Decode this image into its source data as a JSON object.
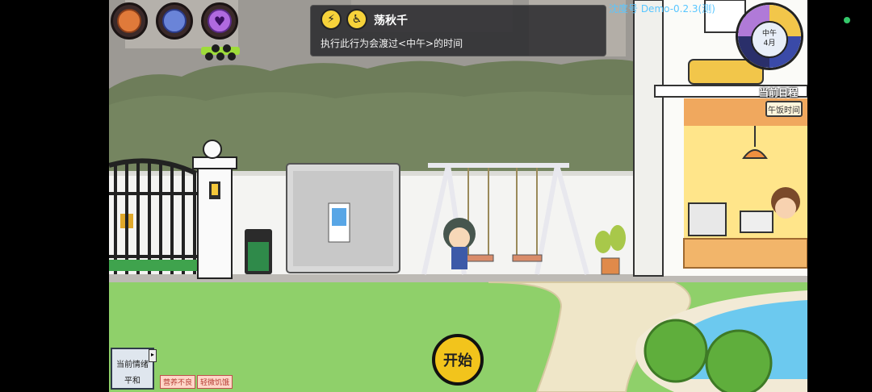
{
  "hud": {
    "stats": [
      {
        "name": "hunger",
        "icon": "gingerbread-icon",
        "color": "#e07a3a"
      },
      {
        "name": "health",
        "icon": "medicine-icon",
        "color": "#6a84d8"
      },
      {
        "name": "mood",
        "icon": "heart-icon",
        "color": "#b06adf"
      }
    ]
  },
  "tooltip": {
    "title": "荡秋千",
    "description": "执行此行为会渡过<中午>的时间",
    "icons": [
      "energy-icon",
      "swing-action-icon"
    ]
  },
  "version_text": "沈度号 Demo-0.2.3(测)",
  "clock": {
    "period": "中午",
    "month": "4月"
  },
  "schedule": {
    "label": "当前日程",
    "current": "午饭时间"
  },
  "mood": {
    "label": "当前情绪",
    "value": "平和"
  },
  "status_tags": [
    "营养不良",
    "轻微饥饿"
  ],
  "start_label": "开始",
  "colors": {
    "grass": "#8fd06a",
    "hedge": "#6e7d5a",
    "wall": "#f4f4f2",
    "start_button": "#f2c41c",
    "version_text": "#58c6ff"
  }
}
